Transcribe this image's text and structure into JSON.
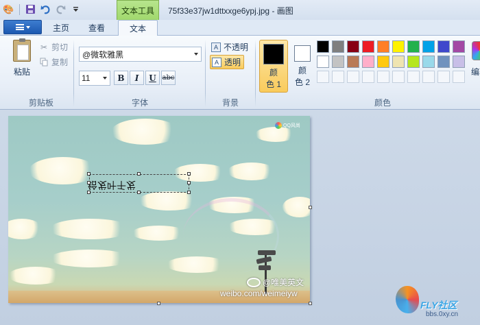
{
  "titlebar": {
    "context_tab": "文本工具",
    "title": "75f33e37jw1dttxxge6ypj.jpg - 画图",
    "qat_icons": [
      "paint-app-icon",
      "save-icon",
      "undo-icon",
      "redo-icon",
      "customize-qat-icon"
    ]
  },
  "tabs": {
    "home": "主页",
    "view": "查看",
    "text": "文本"
  },
  "ribbon": {
    "clipboard": {
      "paste": "粘贴",
      "cut": "剪切",
      "copy": "复制",
      "label": "剪贴板"
    },
    "font": {
      "family": "@微软雅黑",
      "size": "11",
      "bold": "B",
      "italic": "I",
      "underline": "U",
      "strike": "abc",
      "label": "字体"
    },
    "background": {
      "opaque": "不透明",
      "transparent": "透明",
      "label": "背景"
    },
    "colors": {
      "color1_line1": "颜",
      "color1_line2": "色 1",
      "color1_value": "#000000",
      "color2_line1": "颜",
      "color2_line2": "色 2",
      "color2_value": "#ffffff",
      "edit": "编辑",
      "label": "颜色",
      "palette": [
        "#000000",
        "#7f7f7f",
        "#880015",
        "#ed1c24",
        "#ff7f27",
        "#fff200",
        "#22b14c",
        "#00a2e8",
        "#3f48cc",
        "#a349a4",
        "#ffffff",
        "#c3c3c3",
        "#b97a57",
        "#ffaec9",
        "#ffc90e",
        "#efe4b0",
        "#b5e61d",
        "#99d9ea",
        "#7092be",
        "#c8bfe7",
        "",
        "",
        "",
        "",
        "",
        "",
        "",
        "",
        "",
        ""
      ]
    }
  },
  "canvas": {
    "textbox_text": "给发叶千发",
    "watermark_line1": "@唯美英文",
    "watermark_line2": "weibo.com/weimeiyw",
    "qq_logo_text": "QQ风尚"
  },
  "site_logo": {
    "name": "FLY社区",
    "url": "bbs.0xy.cn"
  }
}
